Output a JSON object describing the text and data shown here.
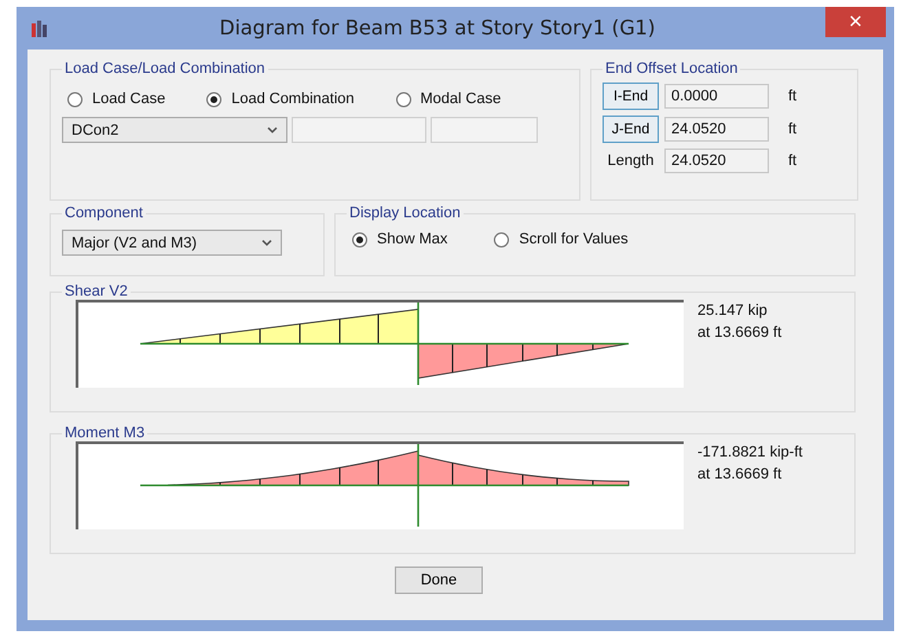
{
  "window": {
    "title": "Diagram for Beam B53 at Story Story1 (G1)",
    "close": "×"
  },
  "load_case": {
    "title": "Load Case/Load Combination",
    "radios": [
      {
        "label": "Load Case",
        "selected": false
      },
      {
        "label": "Load Combination",
        "selected": true
      },
      {
        "label": "Modal Case",
        "selected": false
      }
    ],
    "combo": "DCon2"
  },
  "end_offset": {
    "title": "End Offset Location",
    "rows": [
      {
        "kind": "button",
        "label": "I-End",
        "value": "0.0000",
        "unit": "ft"
      },
      {
        "kind": "button",
        "label": "J-End",
        "value": "24.0520",
        "unit": "ft"
      },
      {
        "kind": "label",
        "label": "Length",
        "value": "24.0520",
        "unit": "ft"
      }
    ]
  },
  "component": {
    "title": "Component",
    "combo": "Major (V2 and M3)"
  },
  "display_location": {
    "title": "Display Location",
    "radios": [
      {
        "label": "Show Max",
        "selected": true
      },
      {
        "label": "Scroll for Values",
        "selected": false
      }
    ]
  },
  "diagrams": [
    {
      "kind": "shear",
      "title": "Shear V2",
      "reading": "25.147 kip",
      "location": "at 13.6669 ft"
    },
    {
      "kind": "moment",
      "title": "Moment M3",
      "reading": "-171.8821 kip-ft",
      "location": "at 13.6669 ft"
    }
  ],
  "buttons": [
    "Done"
  ]
}
